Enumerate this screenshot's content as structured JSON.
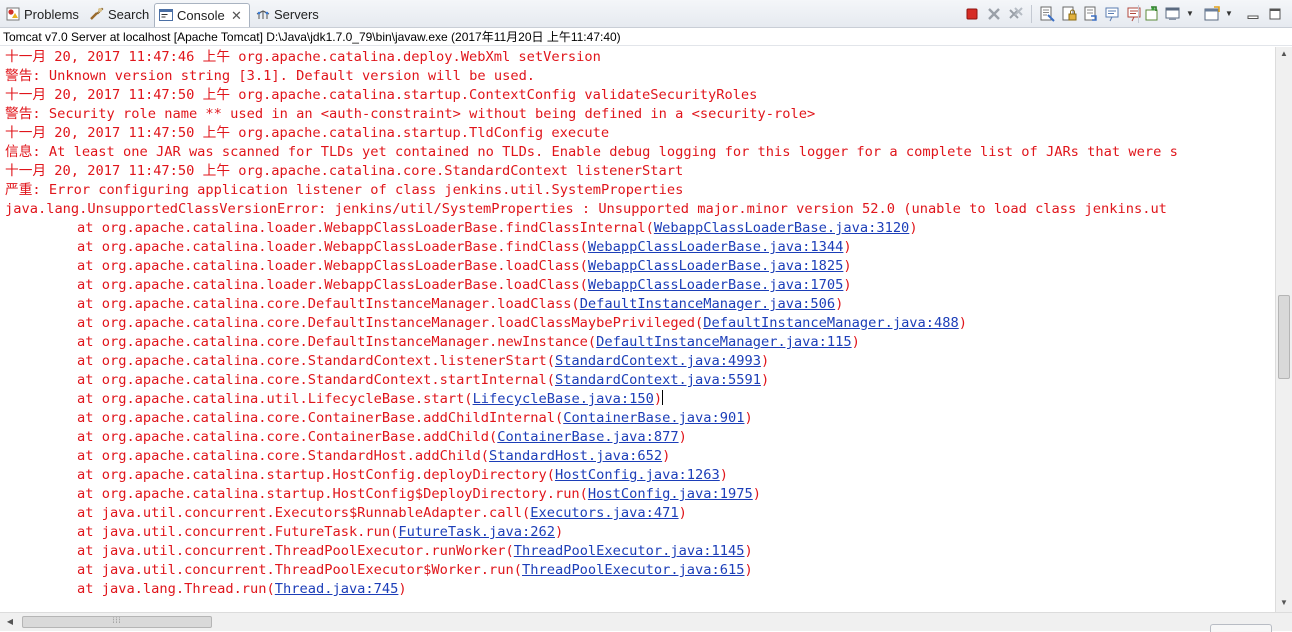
{
  "tabs": [
    {
      "label": "Problems",
      "icon": "problems-icon"
    },
    {
      "label": "Search",
      "icon": "search-icon"
    },
    {
      "label": "Console",
      "icon": "console-icon",
      "active": true,
      "close": "✕"
    },
    {
      "label": "Servers",
      "icon": "servers-icon"
    }
  ],
  "toolbar": {
    "icons": [
      "terminate-icon",
      "remove-launch-icon",
      "remove-all-terminated-icon",
      "clear-console-icon",
      "scroll-lock-icon",
      "word-wrap-icon",
      "show-on-stdout-icon",
      "show-on-stderr-icon",
      "pin-console-icon",
      "display-console-icon",
      "open-console-icon",
      "minimize-icon",
      "maximize-icon"
    ]
  },
  "process_title": "Tomcat v7.0 Server at localhost [Apache Tomcat] D:\\Java\\jdk1.7.0_79\\bin\\javaw.exe (2017年11月20日 上午11:47:40)",
  "console": {
    "lines": [
      "十一月 20, 2017 11:47:46 上午 org.apache.catalina.deploy.WebXml setVersion",
      "警告: Unknown version string [3.1]. Default version will be used.",
      "十一月 20, 2017 11:47:50 上午 org.apache.catalina.startup.ContextConfig validateSecurityRoles",
      "警告: Security role name ** used in an <auth-constraint> without being defined in a <security-role>",
      "十一月 20, 2017 11:47:50 上午 org.apache.catalina.startup.TldConfig execute",
      "信息: At least one JAR was scanned for TLDs yet contained no TLDs. Enable debug logging for this logger for a complete list of JARs that were s",
      "十一月 20, 2017 11:47:50 上午 org.apache.catalina.core.StandardContext listenerStart",
      "严重: Error configuring application listener of class jenkins.util.SystemProperties",
      "java.lang.UnsupportedClassVersionError: jenkins/util/SystemProperties : Unsupported major.minor version 52.0 (unable to load class jenkins.ut"
    ],
    "trace": [
      {
        "at": "at org.apache.catalina.loader.WebappClassLoaderBase.findClassInternal(",
        "link": "WebappClassLoaderBase.java:3120",
        "end": ")"
      },
      {
        "at": "at org.apache.catalina.loader.WebappClassLoaderBase.findClass(",
        "link": "WebappClassLoaderBase.java:1344",
        "end": ")"
      },
      {
        "at": "at org.apache.catalina.loader.WebappClassLoaderBase.loadClass(",
        "link": "WebappClassLoaderBase.java:1825",
        "end": ")"
      },
      {
        "at": "at org.apache.catalina.loader.WebappClassLoaderBase.loadClass(",
        "link": "WebappClassLoaderBase.java:1705",
        "end": ")"
      },
      {
        "at": "at org.apache.catalina.core.DefaultInstanceManager.loadClass(",
        "link": "DefaultInstanceManager.java:506",
        "end": ")"
      },
      {
        "at": "at org.apache.catalina.core.DefaultInstanceManager.loadClassMaybePrivileged(",
        "link": "DefaultInstanceManager.java:488",
        "end": ")"
      },
      {
        "at": "at org.apache.catalina.core.DefaultInstanceManager.newInstance(",
        "link": "DefaultInstanceManager.java:115",
        "end": ")"
      },
      {
        "at": "at org.apache.catalina.core.StandardContext.listenerStart(",
        "link": "StandardContext.java:4993",
        "end": ")"
      },
      {
        "at": "at org.apache.catalina.core.StandardContext.startInternal(",
        "link": "StandardContext.java:5591",
        "end": ")"
      },
      {
        "at": "at org.apache.catalina.util.LifecycleBase.start(",
        "link": "LifecycleBase.java:150",
        "end": ")"
      },
      {
        "at": "at org.apache.catalina.core.ContainerBase.addChildInternal(",
        "link": "ContainerBase.java:901",
        "end": ")"
      },
      {
        "at": "at org.apache.catalina.core.ContainerBase.addChild(",
        "link": "ContainerBase.java:877",
        "end": ")"
      },
      {
        "at": "at org.apache.catalina.core.StandardHost.addChild(",
        "link": "StandardHost.java:652",
        "end": ")"
      },
      {
        "at": "at org.apache.catalina.startup.HostConfig.deployDirectory(",
        "link": "HostConfig.java:1263",
        "end": ")"
      },
      {
        "at": "at org.apache.catalina.startup.HostConfig$DeployDirectory.run(",
        "link": "HostConfig.java:1975",
        "end": ")"
      },
      {
        "at": "at java.util.concurrent.Executors$RunnableAdapter.call(",
        "link": "Executors.java:471",
        "end": ")"
      },
      {
        "at": "at java.util.concurrent.FutureTask.run(",
        "link": "FutureTask.java:262",
        "end": ")"
      },
      {
        "at": "at java.util.concurrent.ThreadPoolExecutor.runWorker(",
        "link": "ThreadPoolExecutor.java:1145",
        "end": ")"
      },
      {
        "at": "at java.util.concurrent.ThreadPoolExecutor$Worker.run(",
        "link": "ThreadPoolExecutor.java:615",
        "end": ")"
      },
      {
        "at": "at java.lang.Thread.run(",
        "link": "Thread.java:745",
        "end": ")"
      }
    ]
  },
  "colors": {
    "stderr": "#e0151b",
    "link": "#1c3eb8"
  }
}
